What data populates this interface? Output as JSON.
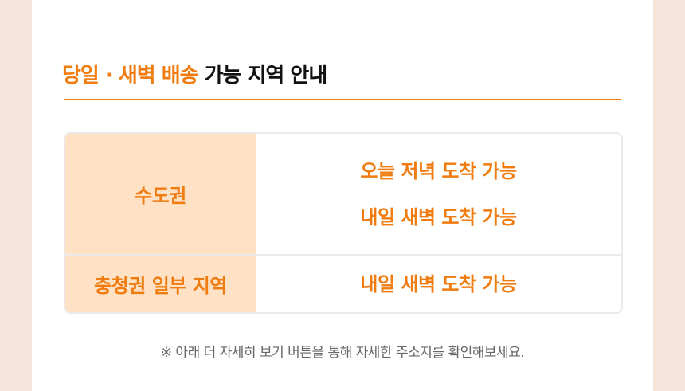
{
  "title": {
    "highlight": "당일 · 새벽 배송",
    "rest": " 가능 지역 안내"
  },
  "table": {
    "rows": [
      {
        "region": "수도권",
        "deliveries": [
          "오늘 저녁 도착 가능",
          "내일 새벽 도착 가능"
        ]
      },
      {
        "region": "충청권 일부 지역",
        "deliveries": [
          "내일 새벽 도착 가능"
        ]
      }
    ]
  },
  "note": "※ 아래 더 자세히 보기 버튼을 통해 자세한 주소지를 확인해보세요.",
  "colors": {
    "accent": "#f07c10",
    "header_bg": "#ffe2c6",
    "page_bg": "#f6e4da",
    "border": "#eaeaea"
  }
}
